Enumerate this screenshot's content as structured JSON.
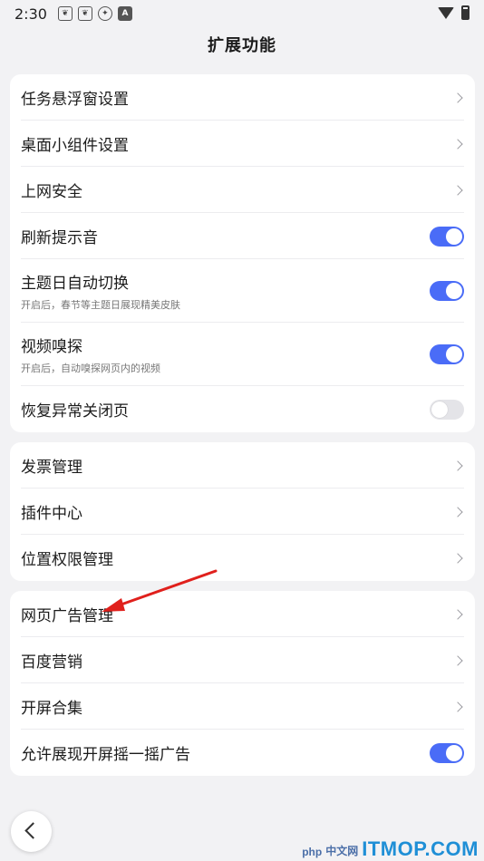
{
  "status_bar": {
    "time": "2:30",
    "icons": [
      "paw-icon",
      "paw-icon",
      "aperture-icon",
      "a-icon",
      "wifi-icon",
      "battery-icon"
    ]
  },
  "header": {
    "title": "扩展功能"
  },
  "groups": [
    {
      "items": [
        {
          "label": "任务悬浮窗设置",
          "control": "chevron"
        },
        {
          "label": "桌面小组件设置",
          "control": "chevron"
        },
        {
          "label": "上网安全",
          "control": "chevron"
        },
        {
          "label": "刷新提示音",
          "control": "toggle",
          "on": true
        },
        {
          "label": "主题日自动切换",
          "sub": "开启后，春节等主题日展现精美皮肤",
          "control": "toggle",
          "on": true
        },
        {
          "label": "视频嗅探",
          "sub": "开启后，自动嗅探网页内的视频",
          "control": "toggle",
          "on": true
        },
        {
          "label": "恢复异常关闭页",
          "control": "toggle",
          "on": false
        }
      ]
    },
    {
      "items": [
        {
          "label": "发票管理",
          "control": "chevron"
        },
        {
          "label": "插件中心",
          "control": "chevron"
        },
        {
          "label": "位置权限管理",
          "control": "chevron"
        }
      ]
    },
    {
      "items": [
        {
          "label": "网页广告管理",
          "control": "chevron"
        },
        {
          "label": "百度营销",
          "control": "chevron"
        },
        {
          "label": "开屏合集",
          "control": "chevron"
        },
        {
          "label": "允许展现开屏摇一摇广告",
          "control": "toggle",
          "on": true
        }
      ]
    }
  ],
  "colors": {
    "accent": "#4a6cf7",
    "background": "#f2f2f4",
    "annotation_arrow": "#e0201c"
  },
  "watermark": {
    "php": "php",
    "cn": "中文网",
    "brand": "ITMOP.COM"
  }
}
